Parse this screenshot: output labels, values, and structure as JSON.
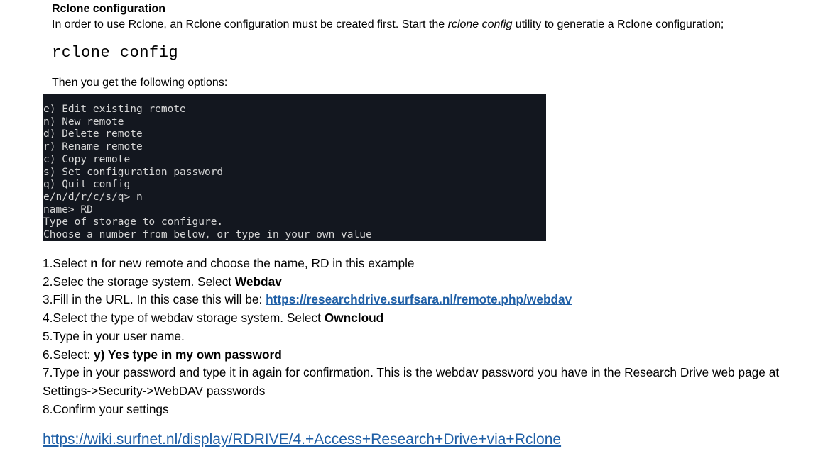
{
  "document": {
    "heading": "Rclone configuration",
    "intro": {
      "before": "In order to use Rclone, an Rclone configuration must be created first. Start the ",
      "emphasis": "rclone config",
      "after": " utility to generatie a Rclone configuration;"
    },
    "command": "rclone config",
    "then_text": "Then you get the following options:",
    "terminal_lines": [
      "e) Edit existing remote",
      "n) New remote",
      "d) Delete remote",
      "r) Rename remote",
      "c) Copy remote",
      "s) Set configuration password",
      "q) Quit config",
      "e/n/d/r/c/s/q> n",
      "name> RD",
      "Type of storage to configure.",
      "Choose a number from below, or type in your own value"
    ],
    "steps": {
      "s1": {
        "a": "1.Select ",
        "b": "n",
        "c": " for new remote and choose the name, RD in this example"
      },
      "s2": {
        "a": "2.Selec the storage system. Select ",
        "b": "Webdav"
      },
      "s3": {
        "a": "3.Fill in the URL. In this case this will be: ",
        "link": "https://researchdrive.surfsara.nl/remote.php/webdav"
      },
      "s4": {
        "a": "4.Select the type of webdav storage system. Select ",
        "b": "Owncloud"
      },
      "s5": {
        "a": "5.Type in your user name."
      },
      "s6": {
        "a": "6.Select: ",
        "b": "y) Yes type in my own password"
      },
      "s7": {
        "a": "7.Type in your password and type it in again for confirmation. This is the webdav password you have in the Research Drive web page at Settings->Security->WebDAV  passwords"
      },
      "s8": {
        "a": "8.Confirm your settings"
      }
    },
    "wiki_link": "https://wiki.surfnet.nl/display/RDRIVE/4.+Access+Research+Drive+via+Rclone"
  }
}
